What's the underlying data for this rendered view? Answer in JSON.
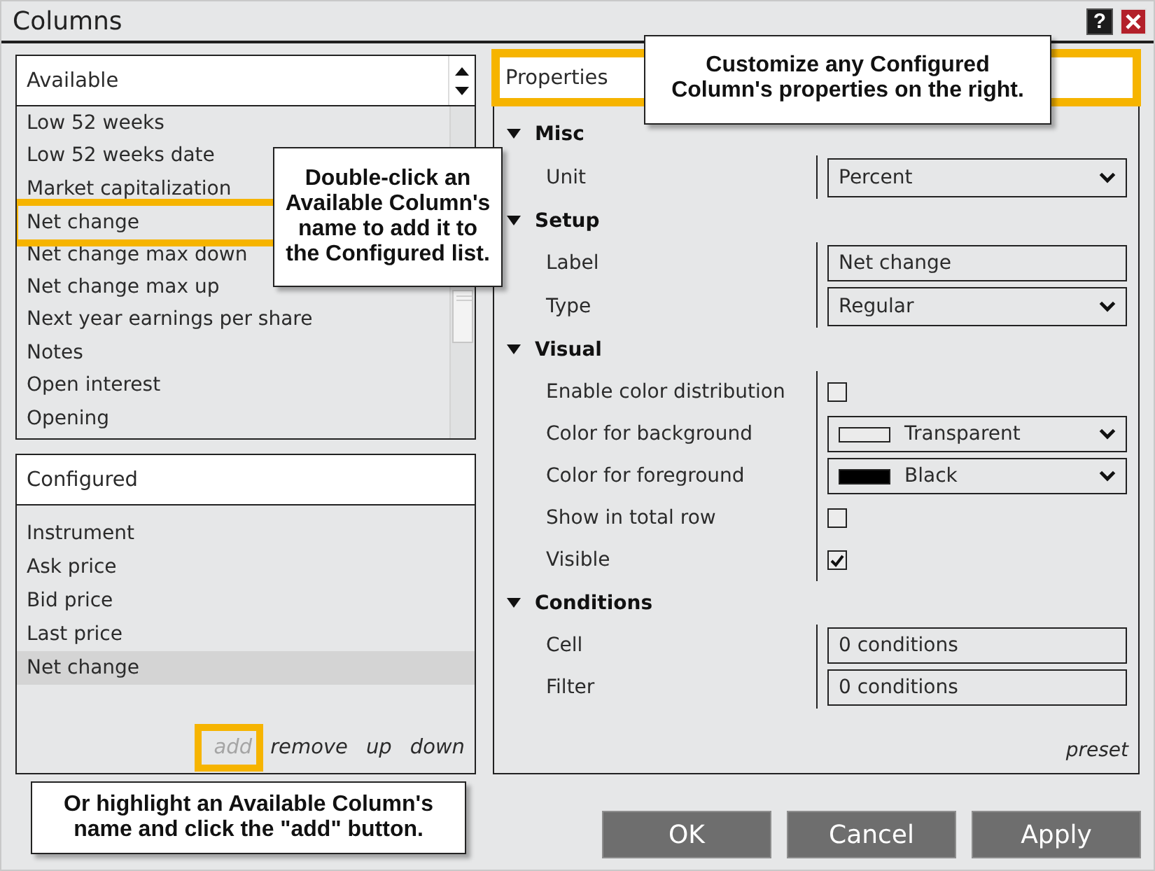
{
  "window": {
    "title": "Columns",
    "help": "?"
  },
  "available": {
    "header": "Available",
    "items": [
      {
        "label": "Low 52 weeks",
        "selected": false,
        "outlined": false
      },
      {
        "label": "Low 52 weeks date",
        "selected": false,
        "outlined": false
      },
      {
        "label": "Market capitalization",
        "selected": false,
        "outlined": false
      },
      {
        "label": "Net change",
        "selected": false,
        "outlined": true
      },
      {
        "label": "Net change max down",
        "selected": false,
        "outlined": false
      },
      {
        "label": "Net change max up",
        "selected": false,
        "outlined": false
      },
      {
        "label": "Next year earnings per share",
        "selected": false,
        "outlined": false
      },
      {
        "label": "Notes",
        "selected": false,
        "outlined": false
      },
      {
        "label": "Open interest",
        "selected": false,
        "outlined": false
      },
      {
        "label": "Opening",
        "selected": false,
        "outlined": false
      }
    ],
    "callout": "Double-click an Available Column's name to add it to the Configured list."
  },
  "configured": {
    "header": "Configured",
    "items": [
      {
        "label": "Instrument",
        "selected": false
      },
      {
        "label": "Ask price",
        "selected": false
      },
      {
        "label": "Bid price",
        "selected": false
      },
      {
        "label": "Last price",
        "selected": false
      },
      {
        "label": "Net change",
        "selected": true
      }
    ],
    "actions": [
      {
        "label": "add",
        "disabled": true,
        "outlined": true
      },
      {
        "label": "remove",
        "disabled": false,
        "outlined": false
      },
      {
        "label": "up",
        "disabled": false,
        "outlined": false
      },
      {
        "label": "down",
        "disabled": false,
        "outlined": false
      }
    ],
    "callout": "Or highlight an Available Column's name and click the \"add\" button."
  },
  "properties": {
    "header": "Properties",
    "outlined": true,
    "callout": "Customize any Configured Column's properties on the right.",
    "categories": [
      {
        "name": "Misc",
        "expanded": true,
        "rows": [
          {
            "label": "Unit",
            "kind": "dropdown",
            "value": "Percent"
          }
        ]
      },
      {
        "name": "Setup",
        "expanded": true,
        "rows": [
          {
            "label": "Label",
            "kind": "text",
            "value": "Net change"
          },
          {
            "label": "Type",
            "kind": "dropdown",
            "value": "Regular"
          }
        ]
      },
      {
        "name": "Visual",
        "expanded": true,
        "rows": [
          {
            "label": "Enable color distribution",
            "kind": "checkbox",
            "checked": false
          },
          {
            "label": "Color for background",
            "kind": "color",
            "value": "Transparent",
            "color": "#ebebeb"
          },
          {
            "label": "Color for foreground",
            "kind": "color",
            "value": "Black",
            "color": "#000000"
          },
          {
            "label": "Show in total row",
            "kind": "checkbox",
            "checked": false
          },
          {
            "label": "Visible",
            "kind": "checkbox",
            "checked": true
          }
        ]
      },
      {
        "name": "Conditions",
        "expanded": true,
        "rows": [
          {
            "label": "Cell",
            "kind": "text",
            "value": "0 conditions"
          },
          {
            "label": "Filter",
            "kind": "text",
            "value": "0 conditions"
          }
        ]
      }
    ],
    "preset": "preset"
  },
  "buttons": [
    "OK",
    "Cancel",
    "Apply"
  ]
}
